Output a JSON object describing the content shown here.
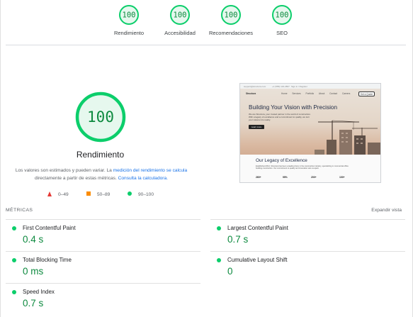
{
  "categories": [
    {
      "score": "100",
      "label": "Rendimiento"
    },
    {
      "score": "100",
      "label": "Accesibilidad"
    },
    {
      "score": "100",
      "label": "Recomendaciones"
    },
    {
      "score": "100",
      "label": "SEO"
    }
  ],
  "performance": {
    "score": "100",
    "title": "Rendimiento",
    "desc_prefix": "Los valores son estimados y pueden variar. La ",
    "desc_link1": "medición del rendimiento se calcula",
    "desc_middle": " directamente a partir de estas métricas. ",
    "desc_link2": "Consulta la calculadora."
  },
  "legend": {
    "fail": "0–49",
    "average": "50–89",
    "pass": "90–100"
  },
  "colors": {
    "pass": "#0cce6b",
    "pass_text": "#0d8a3f",
    "pass_bg": "#e6f8ee",
    "average": "#fb8c00",
    "fail": "#e53935",
    "link": "#1a73e8"
  },
  "screenshot": {
    "bar_left": "support@structura.com",
    "bar_mid": "+1 (555) 123-4567",
    "bar_right": "Sign in / Register",
    "brand": "Structura",
    "nav": "Home   Services   Portfolio   About   Contact   Careers",
    "cta": "Get a Quote",
    "headline": "Building Your Vision with Precision",
    "body": "We are Structura, your trusted partner in the world of construction. With a legacy of excellence and a commitment to quality, we turn your visions into reality.",
    "button": "Learn more",
    "section_title": "Our Legacy of Excellence",
    "section_body": "Established 2012, Structura has been a leading force in the construction industry, specializing in commercial office building construction. Our commitment to quality and innovation sets us apart.",
    "stats": [
      "260+",
      "95%",
      "200+",
      "100+"
    ]
  },
  "metrics_section": {
    "title": "MÉTRICAS",
    "expand": "Expandir vista"
  },
  "metrics_left": [
    {
      "name": "First Contentful Paint",
      "value": "0.4 s"
    },
    {
      "name": "Total Blocking Time",
      "value": "0 ms"
    },
    {
      "name": "Speed Index",
      "value": "0.7 s"
    }
  ],
  "metrics_right": [
    {
      "name": "Largest Contentful Paint",
      "value": "0.7 s"
    },
    {
      "name": "Cumulative Layout Shift",
      "value": "0"
    }
  ]
}
